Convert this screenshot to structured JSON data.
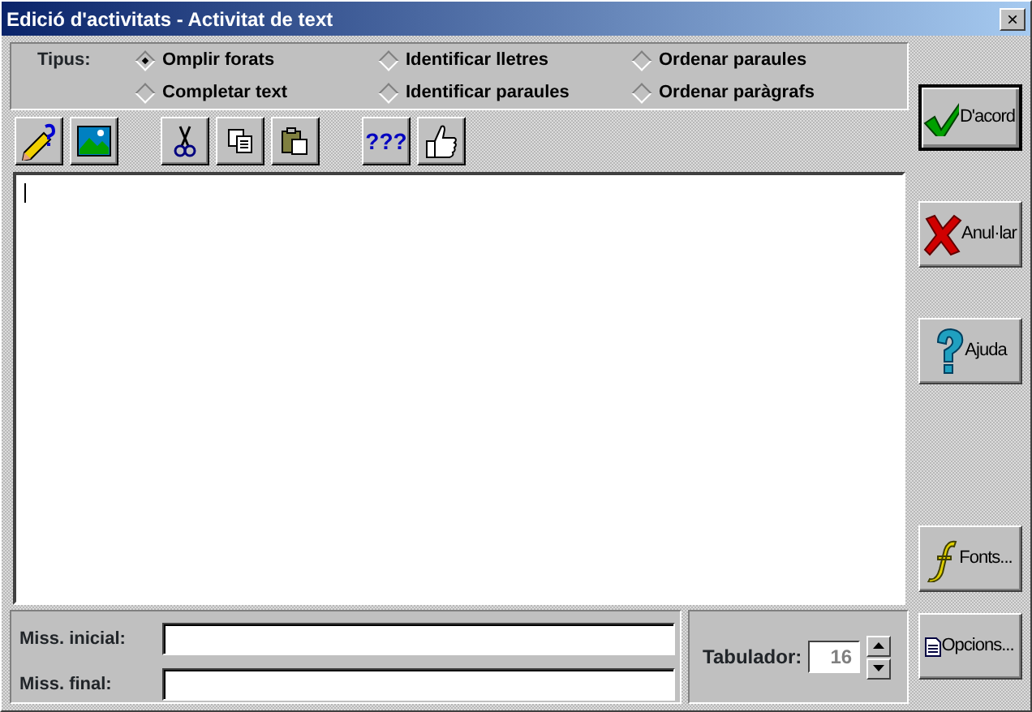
{
  "window": {
    "title": "Edició d'activitats - Activitat de text",
    "close": "×"
  },
  "type_group": {
    "label": "Tipus:",
    "options": [
      {
        "label": "Omplir forats",
        "selected": true
      },
      {
        "label": "Identificar lletres",
        "selected": false
      },
      {
        "label": "Ordenar paraules",
        "selected": false
      },
      {
        "label": "Completar text",
        "selected": false
      },
      {
        "label": "Identificar paraules",
        "selected": false
      },
      {
        "label": "Ordenar paràgrafs",
        "selected": false
      }
    ]
  },
  "toolbar": [
    {
      "buttons": [
        {
          "kind": "pencil"
        },
        {
          "kind": "image"
        }
      ]
    },
    {
      "buttons": [
        {
          "kind": "cut"
        },
        {
          "kind": "copy"
        },
        {
          "kind": "paste"
        }
      ]
    },
    {
      "buttons": [
        {
          "kind": "text",
          "label": "???"
        },
        {
          "kind": "thumb"
        }
      ]
    }
  ],
  "messages": [
    {
      "label": "Miss. inicial:"
    },
    {
      "label": "Miss. final:"
    }
  ],
  "tab_field": {
    "label": "Tabulador:",
    "value": "16",
    "disabled": true
  },
  "buttons": [
    {
      "kind": "check",
      "label": "D'acord",
      "default": true
    },
    {
      "kind": "cross",
      "label": "Anul·lar",
      "default": false
    },
    {
      "kind": "help",
      "label": "Ajuda",
      "default": false
    },
    {
      "kind": "font",
      "label": "Fonts...",
      "default": false
    },
    {
      "kind": "doc",
      "label": "Opcions...",
      "default": false
    }
  ]
}
